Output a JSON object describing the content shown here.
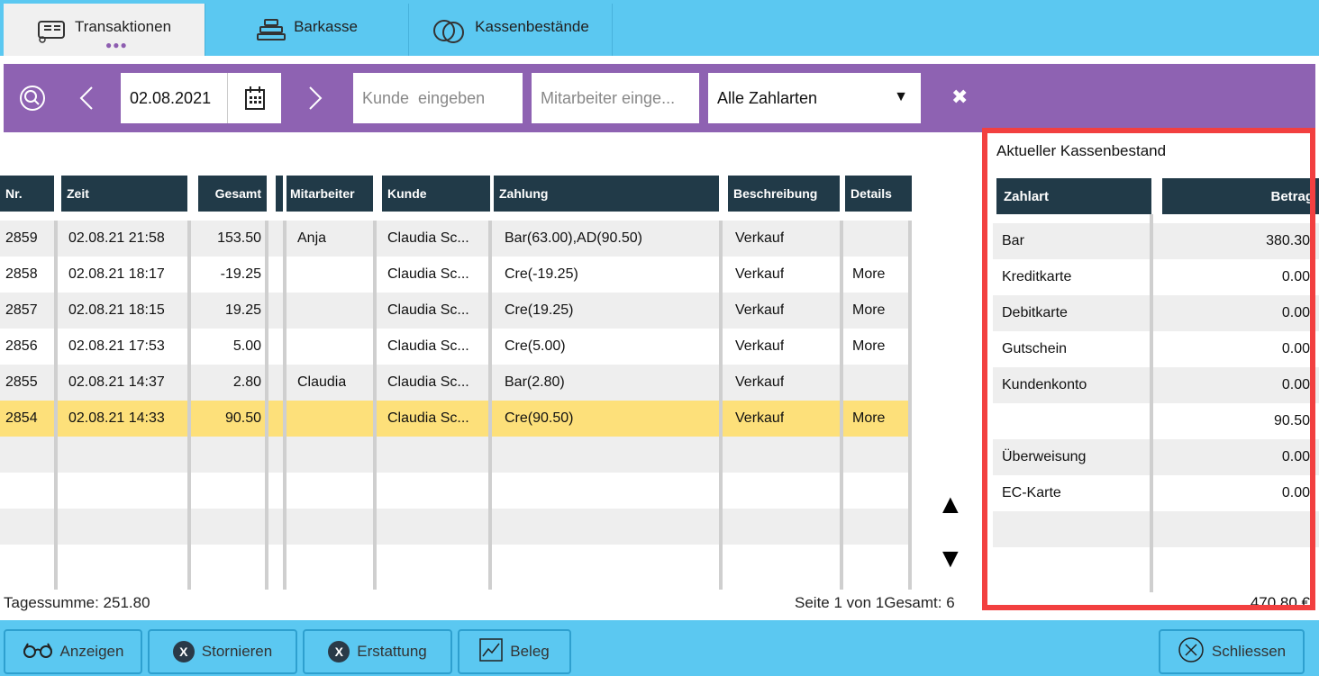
{
  "tabs": [
    {
      "label": "Transaktionen",
      "icon": "receipt-icon",
      "active": true
    },
    {
      "label": "Barkasse",
      "icon": "cash-register-icon",
      "active": false
    },
    {
      "label": "Kassenbestände",
      "icon": "coins-icon",
      "active": false
    }
  ],
  "tab_dots": "●●●",
  "filter": {
    "date": "02.08.2021",
    "customer_placeholder": "Kunde  eingeben",
    "employee_placeholder": "Mitarbeiter einge...",
    "payment_select": "Alle Zahlarten",
    "clear_label": "✖"
  },
  "table": {
    "headers": {
      "nr": "Nr.",
      "zeit": "Zeit",
      "gesamt": "Gesamt",
      "mitarbeiter": "Mitarbeiter",
      "kunde": "Kunde",
      "zahlung": "Zahlung",
      "beschreibung": "Beschreibung",
      "details": "Details"
    },
    "rows": [
      {
        "nr": "2859",
        "zeit": "02.08.21 21:58",
        "gesamt": "153.50",
        "mitarbeiter": "Anja",
        "kunde": "Claudia  Sc...",
        "zahlung": "Bar(63.00),AD(90.50)",
        "beschreibung": "Verkauf",
        "details": ""
      },
      {
        "nr": "2858",
        "zeit": "02.08.21 18:17",
        "gesamt": "-19.25",
        "mitarbeiter": "",
        "kunde": "Claudia  Sc...",
        "zahlung": "Cre(-19.25)",
        "beschreibung": "Verkauf",
        "details": "More"
      },
      {
        "nr": "2857",
        "zeit": "02.08.21 18:15",
        "gesamt": "19.25",
        "mitarbeiter": "",
        "kunde": "Claudia  Sc...",
        "zahlung": "Cre(19.25)",
        "beschreibung": "Verkauf",
        "details": "More"
      },
      {
        "nr": "2856",
        "zeit": "02.08.21 17:53",
        "gesamt": "5.00",
        "mitarbeiter": "",
        "kunde": "Claudia  Sc...",
        "zahlung": "Cre(5.00)",
        "beschreibung": "Verkauf",
        "details": "More"
      },
      {
        "nr": "2855",
        "zeit": "02.08.21 14:37",
        "gesamt": "2.80",
        "mitarbeiter": "Claudia",
        "kunde": "Claudia  Sc...",
        "zahlung": "Bar(2.80)",
        "beschreibung": "Verkauf",
        "details": ""
      },
      {
        "nr": "2854",
        "zeit": "02.08.21 14:33",
        "gesamt": "90.50",
        "mitarbeiter": "",
        "kunde": "Claudia  Sc...",
        "zahlung": "Cre(90.50)",
        "beschreibung": "Verkauf",
        "details": "More"
      }
    ],
    "selected_nr": "2854"
  },
  "status": {
    "day_sum": "Tagessumme: 251.80",
    "page_info": "Seite 1 von 1Gesamt: 6"
  },
  "cash": {
    "title": "Aktueller Kassenbestand",
    "header_type": "Zahlart",
    "header_amount": "Betrag",
    "rows": [
      {
        "type": "Bar",
        "amount": "380.30"
      },
      {
        "type": "Kreditkarte",
        "amount": "0.00"
      },
      {
        "type": "Debitkarte",
        "amount": "0.00"
      },
      {
        "type": "Gutschein",
        "amount": "0.00"
      },
      {
        "type": "Kundenkonto",
        "amount": "0.00"
      },
      {
        "type": "",
        "amount": "90.50"
      },
      {
        "type": "Überweisung",
        "amount": "0.00"
      },
      {
        "type": "EC-Karte",
        "amount": "0.00"
      }
    ],
    "total": "470,80 €"
  },
  "buttons": {
    "show": "Anzeigen",
    "cancel": "Stornieren",
    "refund": "Erstattung",
    "receipt": "Beleg",
    "close": "Schliessen"
  },
  "colors": {
    "accent_blue": "#5bc8f1",
    "filter_purple": "#8e62b2",
    "header_dark": "#213a48",
    "selected_row": "#fde07a",
    "highlight_frame": "#f24040"
  }
}
